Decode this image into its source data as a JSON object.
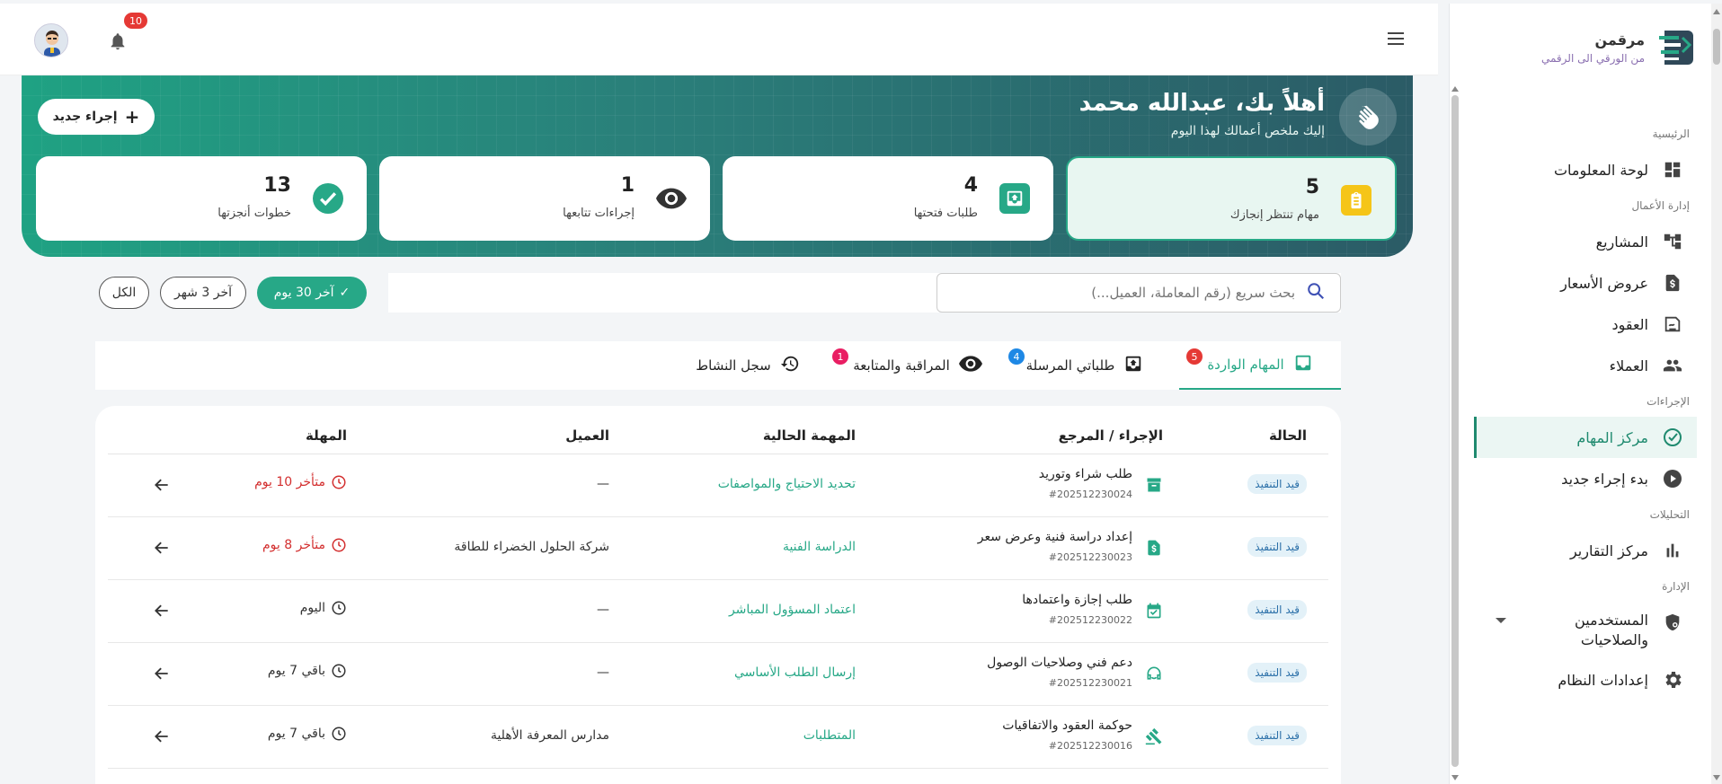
{
  "brand": {
    "name": "مرقمن",
    "tagline": "من الورقي الى الرقمي"
  },
  "header": {
    "notifications_count": "10"
  },
  "sidebar": {
    "sections": [
      {
        "title": "الرئيسية",
        "items": [
          {
            "label": "لوحة المعلومات",
            "icon": "dashboard-icon"
          }
        ]
      },
      {
        "title": "إدارة الأعمال",
        "items": [
          {
            "label": "المشاريع",
            "icon": "projects-icon"
          },
          {
            "label": "عروض الأسعار",
            "icon": "quote-icon"
          },
          {
            "label": "العقود",
            "icon": "contract-icon"
          },
          {
            "label": "العملاء",
            "icon": "clients-icon"
          }
        ]
      },
      {
        "title": "الإجراءات",
        "items": [
          {
            "label": "مركز المهام",
            "icon": "check-circle-icon",
            "active": true
          },
          {
            "label": "بدء إجراء جديد",
            "icon": "play-icon"
          }
        ]
      },
      {
        "title": "التحليلات",
        "items": [
          {
            "label": "مركز التقارير",
            "icon": "bar-chart-icon"
          }
        ]
      },
      {
        "title": "الإدارة",
        "items": [
          {
            "label": "المستخدمين والصلاحيات",
            "line1": "المستخدمين",
            "line2": "والصلاحيات",
            "icon": "shield-icon"
          },
          {
            "label": "إعدادات النظام",
            "icon": "gear-icon"
          }
        ]
      }
    ]
  },
  "hero": {
    "greeting": "أهلاً بك، عبدالله محمد",
    "subtitle": "إليك ملخص أعمالك لهذا اليوم",
    "new_button": "إجراء جديد",
    "stats": [
      {
        "value": "5",
        "label": "مهام تنتظر إنجازك",
        "icon": "clipboard-icon",
        "color": "#f5c518"
      },
      {
        "value": "4",
        "label": "طلبات فتحتها",
        "icon": "inbox-upload-icon",
        "color": "#27a887"
      },
      {
        "value": "1",
        "label": "إجراءات تتابعها",
        "icon": "eye-icon",
        "color": "#333333"
      },
      {
        "value": "13",
        "label": "خطوات أنجزتها",
        "icon": "check-icon",
        "color": "#27a887"
      }
    ]
  },
  "filters": {
    "search_placeholder": "بحث سريع (رقم المعاملة، العميل...)",
    "chips": [
      "آخر 30 يوم",
      "آخر 3 شهر",
      "الكل"
    ]
  },
  "tabs": [
    {
      "label": "المهام الواردة",
      "badge": "5",
      "icon": "inbox-icon",
      "badge_color": "#e53935"
    },
    {
      "label": "طلباتي المرسلة",
      "badge": "4",
      "icon": "outbox-icon",
      "badge_color": "#1e88e5"
    },
    {
      "label": "المراقبة والمتابعة",
      "badge": "1",
      "icon": "eye-icon",
      "badge_color": "#e91e63"
    },
    {
      "label": "سجل النشاط",
      "icon": "history-icon"
    }
  ],
  "table": {
    "headers": {
      "status": "الحالة",
      "procedure": "الإجراء / المرجع",
      "task": "المهمة الحالية",
      "client": "العميل",
      "deadline": "المهلة"
    },
    "rows": [
      {
        "status": "قيد التنفيذ",
        "title": "طلب شراء وتوريد",
        "ref": "#202512230024",
        "task": "تحديد الاحتياج والمواصفات",
        "client": "—",
        "deadline": "متأخر 10 يوم",
        "late": true,
        "icon": "archive-icon"
      },
      {
        "status": "قيد التنفيذ",
        "title": "إعداد دراسة فنية وعرض سعر",
        "ref": "#202512230023",
        "task": "الدراسة الفنية",
        "client": "شركة الحلول الخضراء للطاقة",
        "deadline": "متأخر 8 يوم",
        "late": true,
        "icon": "dollar-doc-icon"
      },
      {
        "status": "قيد التنفيذ",
        "title": "طلب إجازة واعتمادها",
        "ref": "#202512230022",
        "task": "اعتماد المسؤول المباشر",
        "client": "—",
        "deadline": "اليوم",
        "late": false,
        "icon": "calendar-check-icon"
      },
      {
        "status": "قيد التنفيذ",
        "title": "دعم فني وصلاحيات الوصول",
        "ref": "#202512230021",
        "task": "إرسال الطلب الأساسي",
        "client": "—",
        "deadline": "باقي 7 يوم",
        "late": false,
        "icon": "support-icon"
      },
      {
        "status": "قيد التنفيذ",
        "title": "حوكمة العقود والاتفاقيات",
        "ref": "#202512230016",
        "task": "المتطلبات",
        "client": "مدارس المعرفة الأهلية",
        "deadline": "باقي 7 يوم",
        "late": false,
        "icon": "gavel-icon"
      }
    ]
  },
  "colors": {
    "primary": "#27a887",
    "late": "#d32f2f",
    "status_bg": "#e3f1f8",
    "status_text": "#2a6fa8"
  }
}
